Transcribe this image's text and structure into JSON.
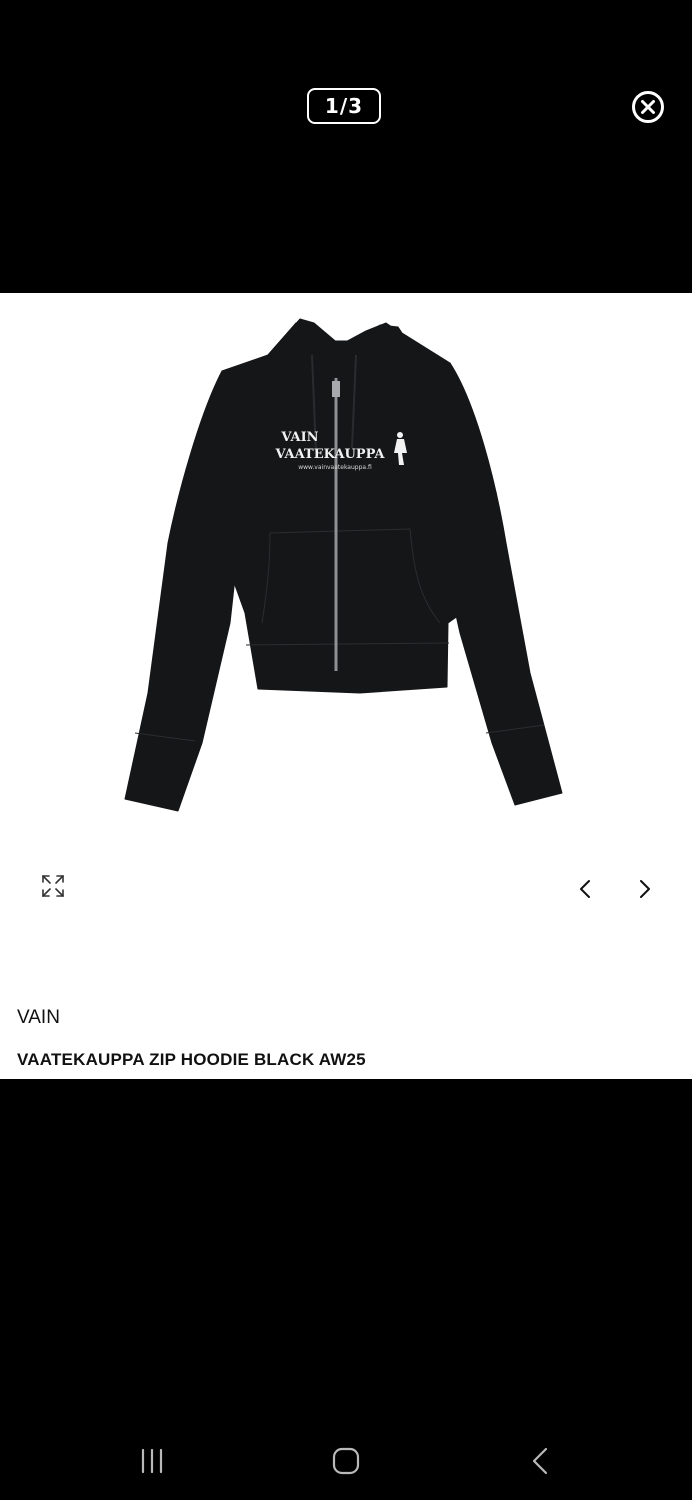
{
  "viewer": {
    "counter": "1/3",
    "icons": {
      "close": "close-circle-icon",
      "expand": "expand-arrows-icon",
      "prev": "chevron-left-icon",
      "next": "chevron-right-icon"
    }
  },
  "product": {
    "brand": "VAIN",
    "title": "VAATEKAUPPA ZIP HOODIE BLACK AW25",
    "print": {
      "line1": "VAIN",
      "line2": "VAATEKAUPPA",
      "line3": "www.vainvaatekauppa.fi"
    },
    "garment_color": "#151618"
  },
  "system_nav": {
    "icons": {
      "recent": "recent-apps-icon",
      "home": "home-icon",
      "back": "back-icon"
    }
  }
}
